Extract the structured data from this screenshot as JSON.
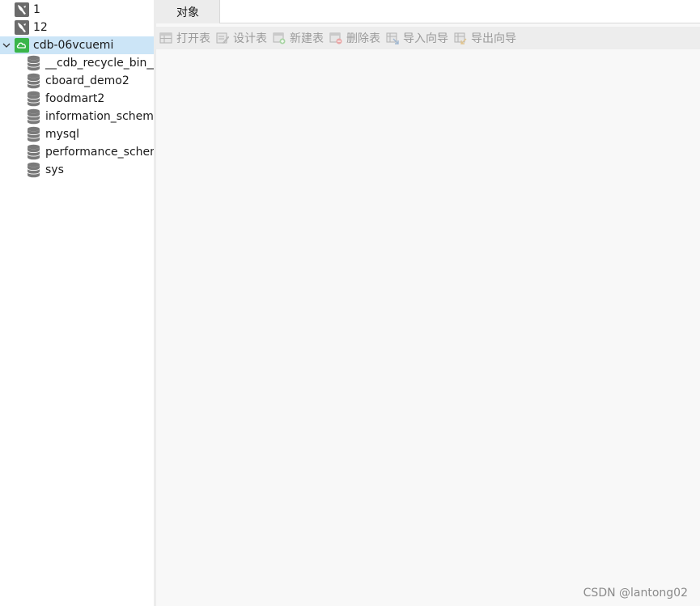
{
  "sidebar": {
    "connections": [
      {
        "label": "1",
        "icon": "mysql-dolphin-icon"
      },
      {
        "label": "12",
        "icon": "mysql-dolphin-icon"
      },
      {
        "label": "cdb-06vcuemi",
        "icon": "cloud-connection-icon",
        "expanded": true,
        "selected": true
      }
    ],
    "databases": [
      {
        "label": "__cdb_recycle_bin__"
      },
      {
        "label": "cboard_demo2"
      },
      {
        "label": "foodmart2"
      },
      {
        "label": "information_schema"
      },
      {
        "label": "mysql"
      },
      {
        "label": "performance_schema"
      },
      {
        "label": "sys"
      }
    ]
  },
  "tabs": [
    {
      "label": "对象",
      "active": true
    }
  ],
  "toolbar": {
    "open_table": "打开表",
    "design_table": "设计表",
    "new_table": "新建表",
    "delete_table": "删除表",
    "import_wizard": "导入向导",
    "export_wizard": "导出向导"
  },
  "watermark": "CSDN @lantong02",
  "colors": {
    "selection": "#cce5f7",
    "cloud_icon": "#39b54a",
    "dolphin_icon_bg": "#6b6b6b",
    "db_icon": "#7a7a7a",
    "toolbar_disabled_text": "#9a9a9a"
  }
}
